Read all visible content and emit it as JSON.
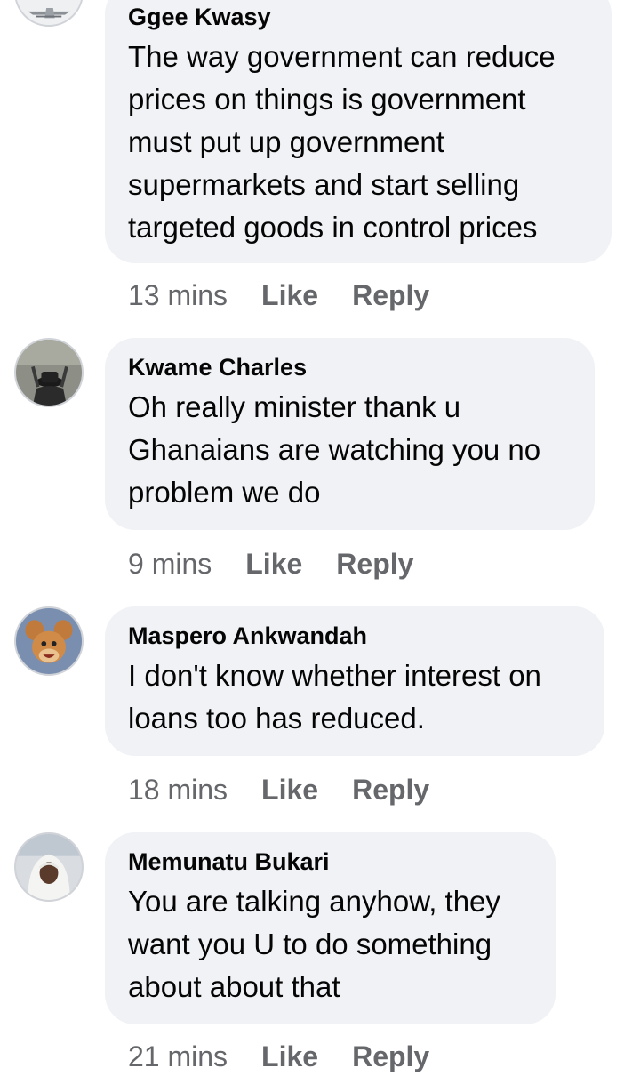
{
  "comments": [
    {
      "author": "Ggee Kwasy",
      "text": "The way government can reduce prices on things is government must put up government supermarkets and start selling targeted goods in control prices",
      "time": "13 mins",
      "like": "Like",
      "reply": "Reply"
    },
    {
      "author": "Kwame Charles",
      "text": "Oh really minister thank u Ghanaians are watching you no problem we do",
      "time": "9 mins",
      "like": "Like",
      "reply": "Reply"
    },
    {
      "author": "Maspero Ankwandah",
      "text": "I don't know whether interest on loans too has reduced.",
      "time": "18 mins",
      "like": "Like",
      "reply": "Reply"
    },
    {
      "author": "Memunatu Bukari",
      "text": "You are talking anyhow, they want you U to do something about about that",
      "time": "21 mins",
      "like": "Like",
      "reply": "Reply"
    }
  ],
  "colors": {
    "bubble": "#f0f2f5",
    "text": "#050505",
    "meta": "#65676b"
  },
  "icons": [
    "avatar-photo-airplane",
    "avatar-photo-man-hat",
    "avatar-photo-cartoon-mouse",
    "avatar-photo-woman-hijab"
  ]
}
